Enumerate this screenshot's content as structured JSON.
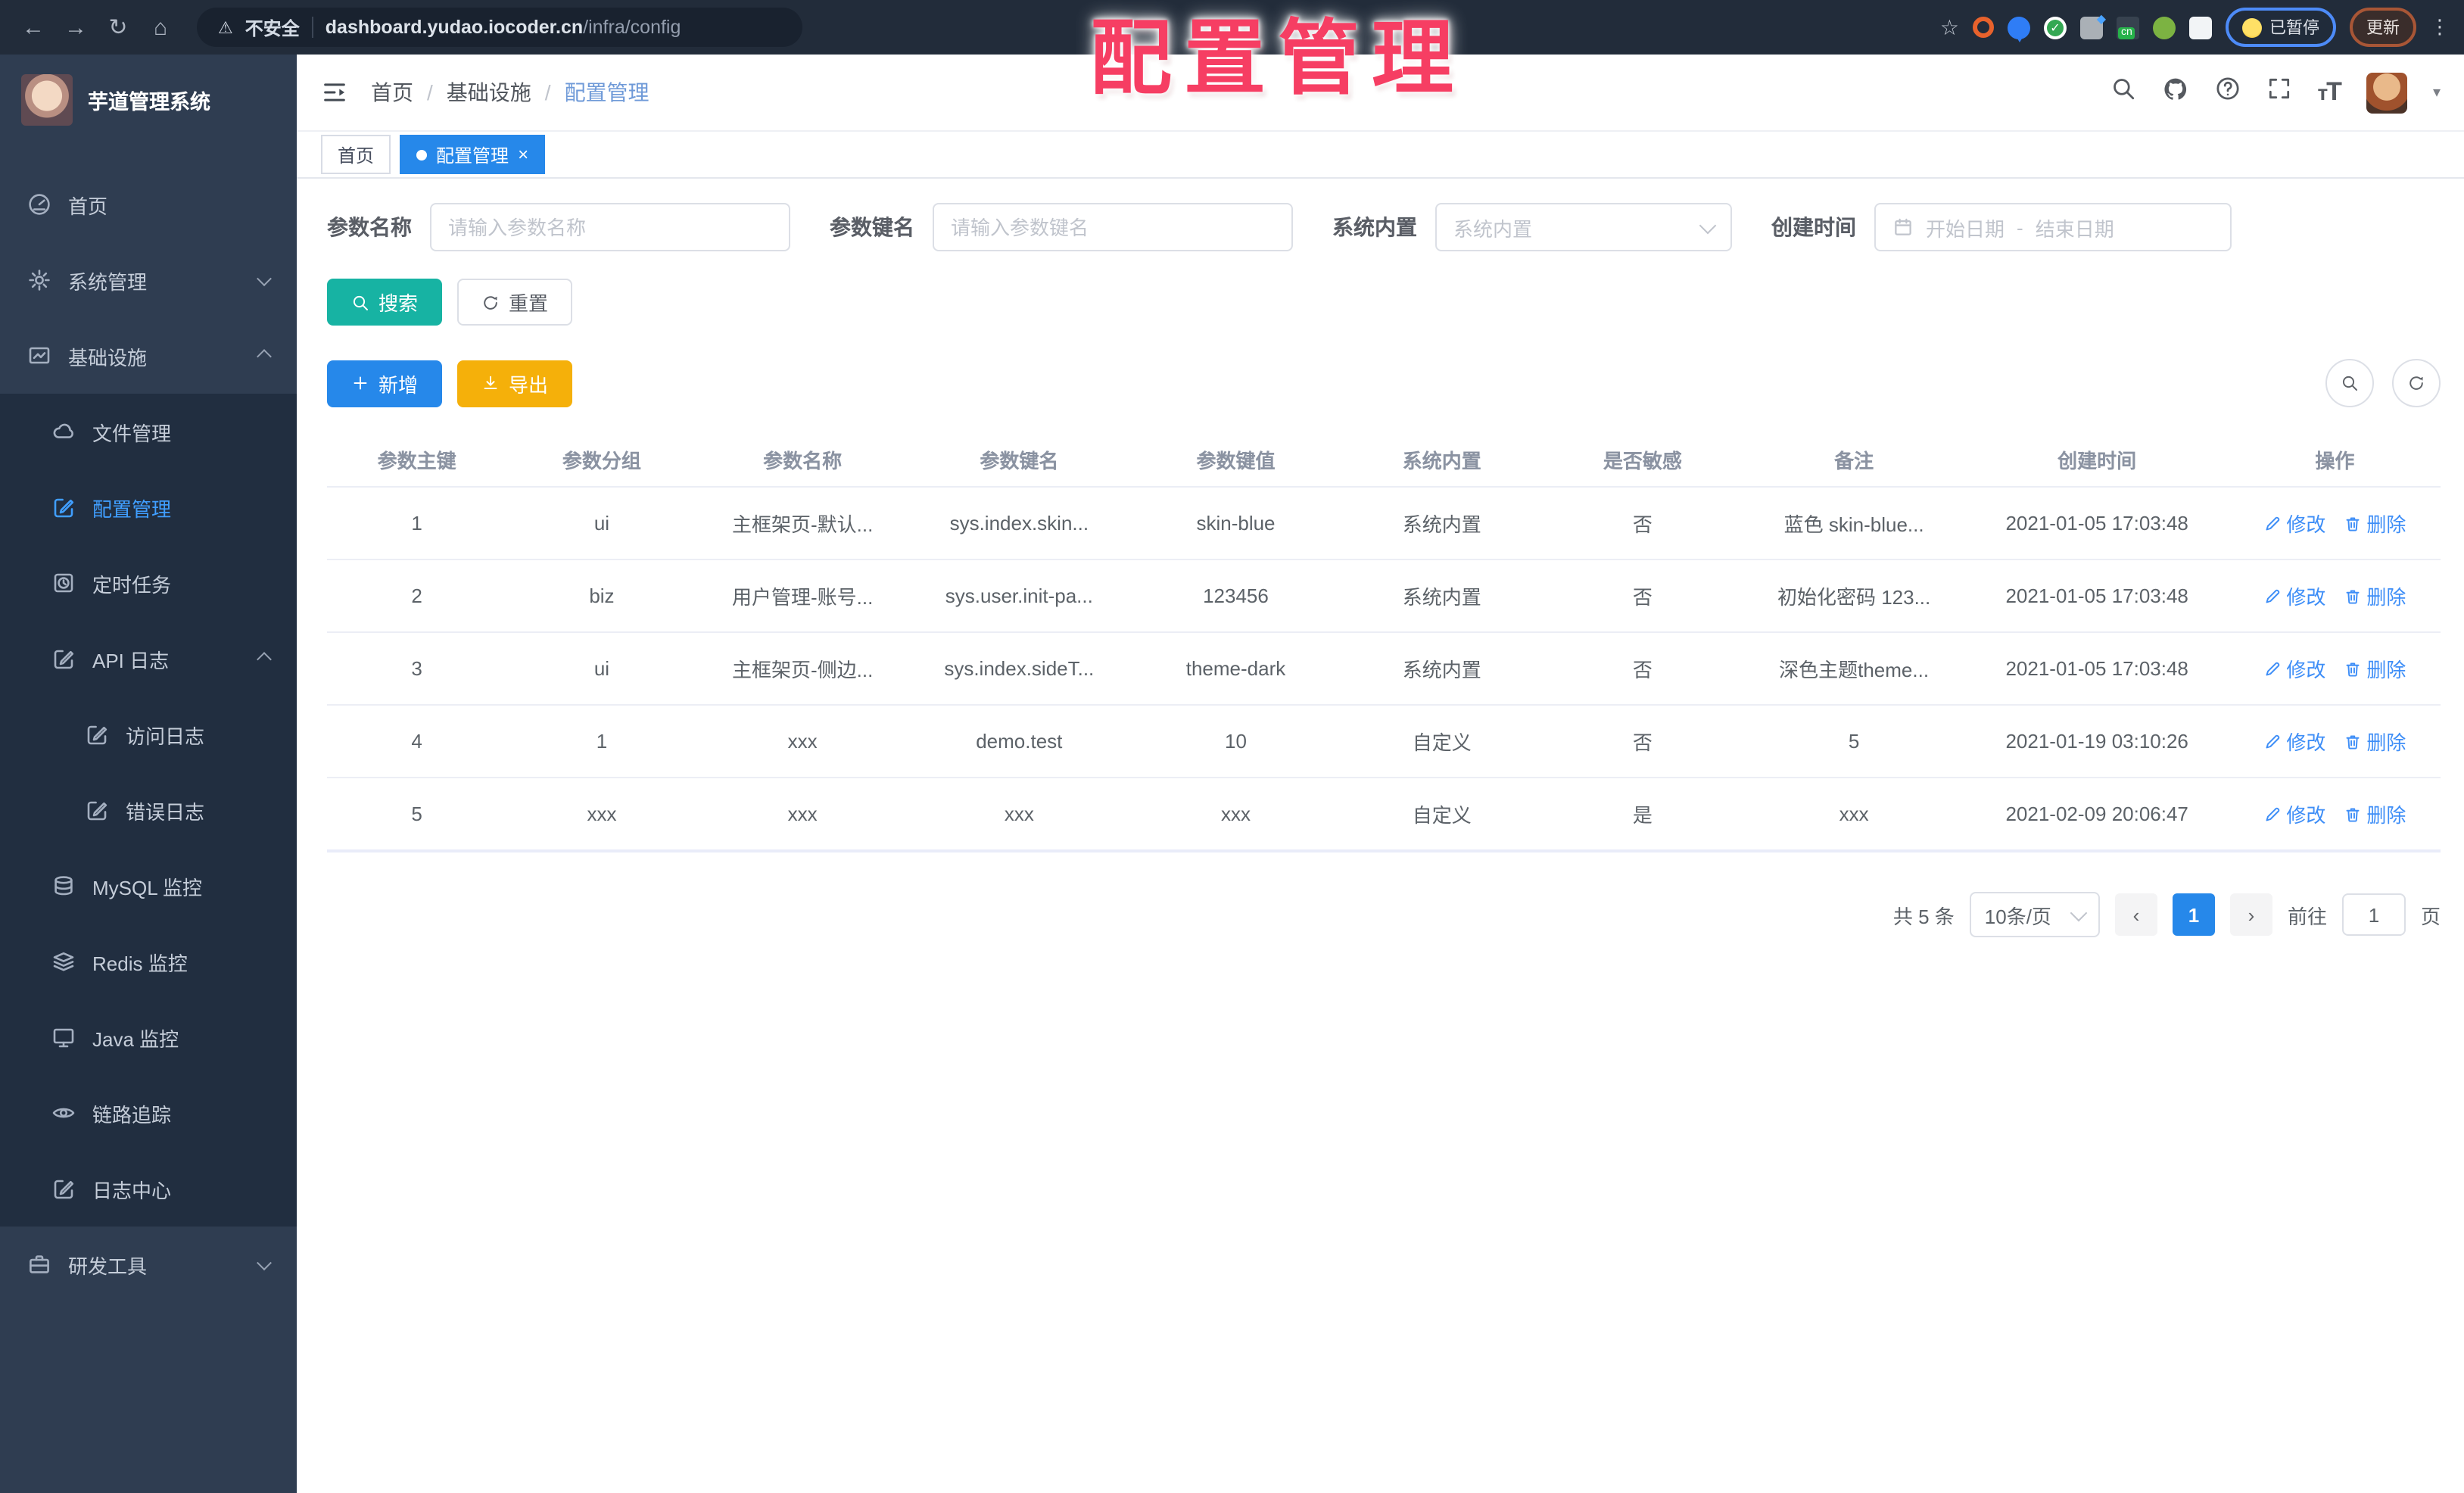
{
  "overlay_title": "配置管理",
  "browser": {
    "insecure_label": "不安全",
    "url_domain": "dashboard.yudao.iocoder.cn",
    "url_path": "/infra/config",
    "paused_label": "已暂停",
    "update_label": "更新"
  },
  "sidebar": {
    "title": "芋道管理系统",
    "items": [
      {
        "label": "首页"
      },
      {
        "label": "系统管理"
      },
      {
        "label": "基础设施"
      },
      {
        "label": "文件管理"
      },
      {
        "label": "配置管理"
      },
      {
        "label": "定时任务"
      },
      {
        "label": "API 日志"
      },
      {
        "label": "访问日志"
      },
      {
        "label": "错误日志"
      },
      {
        "label": "MySQL 监控"
      },
      {
        "label": "Redis 监控"
      },
      {
        "label": "Java 监控"
      },
      {
        "label": "链路追踪"
      },
      {
        "label": "日志中心"
      },
      {
        "label": "研发工具"
      }
    ]
  },
  "navbar": {
    "breadcrumb": [
      "首页",
      "基础设施",
      "配置管理"
    ]
  },
  "tabs": [
    {
      "label": "首页"
    },
    {
      "label": "配置管理"
    }
  ],
  "filters": {
    "name_label": "参数名称",
    "name_placeholder": "请输入参数名称",
    "key_label": "参数键名",
    "key_placeholder": "请输入参数键名",
    "builtin_label": "系统内置",
    "builtin_placeholder": "系统内置",
    "time_label": "创建时间",
    "start_placeholder": "开始日期",
    "range_sep": "-",
    "end_placeholder": "结束日期",
    "search_label": "搜索",
    "reset_label": "重置"
  },
  "toolbar": {
    "add_label": "新增",
    "export_label": "导出"
  },
  "table": {
    "headers": [
      "参数主键",
      "参数分组",
      "参数名称",
      "参数键名",
      "参数键值",
      "系统内置",
      "是否敏感",
      "备注",
      "创建时间",
      "操作"
    ],
    "action_edit": "修改",
    "action_delete": "删除",
    "rows": [
      {
        "cells": [
          "1",
          "ui",
          "主框架页-默认...",
          "sys.index.skin...",
          "skin-blue",
          "系统内置",
          "否",
          "蓝色 skin-blue...",
          "2021-01-05 17:03:48"
        ]
      },
      {
        "cells": [
          "2",
          "biz",
          "用户管理-账号...",
          "sys.user.init-pa...",
          "123456",
          "系统内置",
          "否",
          "初始化密码 123...",
          "2021-01-05 17:03:48"
        ]
      },
      {
        "cells": [
          "3",
          "ui",
          "主框架页-侧边...",
          "sys.index.sideT...",
          "theme-dark",
          "系统内置",
          "否",
          "深色主题theme...",
          "2021-01-05 17:03:48"
        ]
      },
      {
        "cells": [
          "4",
          "1",
          "xxx",
          "demo.test",
          "10",
          "自定义",
          "否",
          "5",
          "2021-01-19 03:10:26"
        ]
      },
      {
        "cells": [
          "5",
          "xxx",
          "xxx",
          "xxx",
          "xxx",
          "自定义",
          "是",
          "xxx",
          "2021-02-09 20:06:47"
        ]
      }
    ]
  },
  "pagination": {
    "total": "共 5 条",
    "page_size": "10条/页",
    "prev": "‹",
    "page": "1",
    "next": "›",
    "goto_label": "前往",
    "goto_value": "1",
    "unit_label": "页"
  },
  "colors": {
    "accent_blue": "#2688ea",
    "teal": "#17b3a3",
    "amber": "#f5b00a",
    "overlay_red": "#f63e63",
    "sidebar_bg": "#2f3d51",
    "submenu_bg": "#212e40"
  }
}
